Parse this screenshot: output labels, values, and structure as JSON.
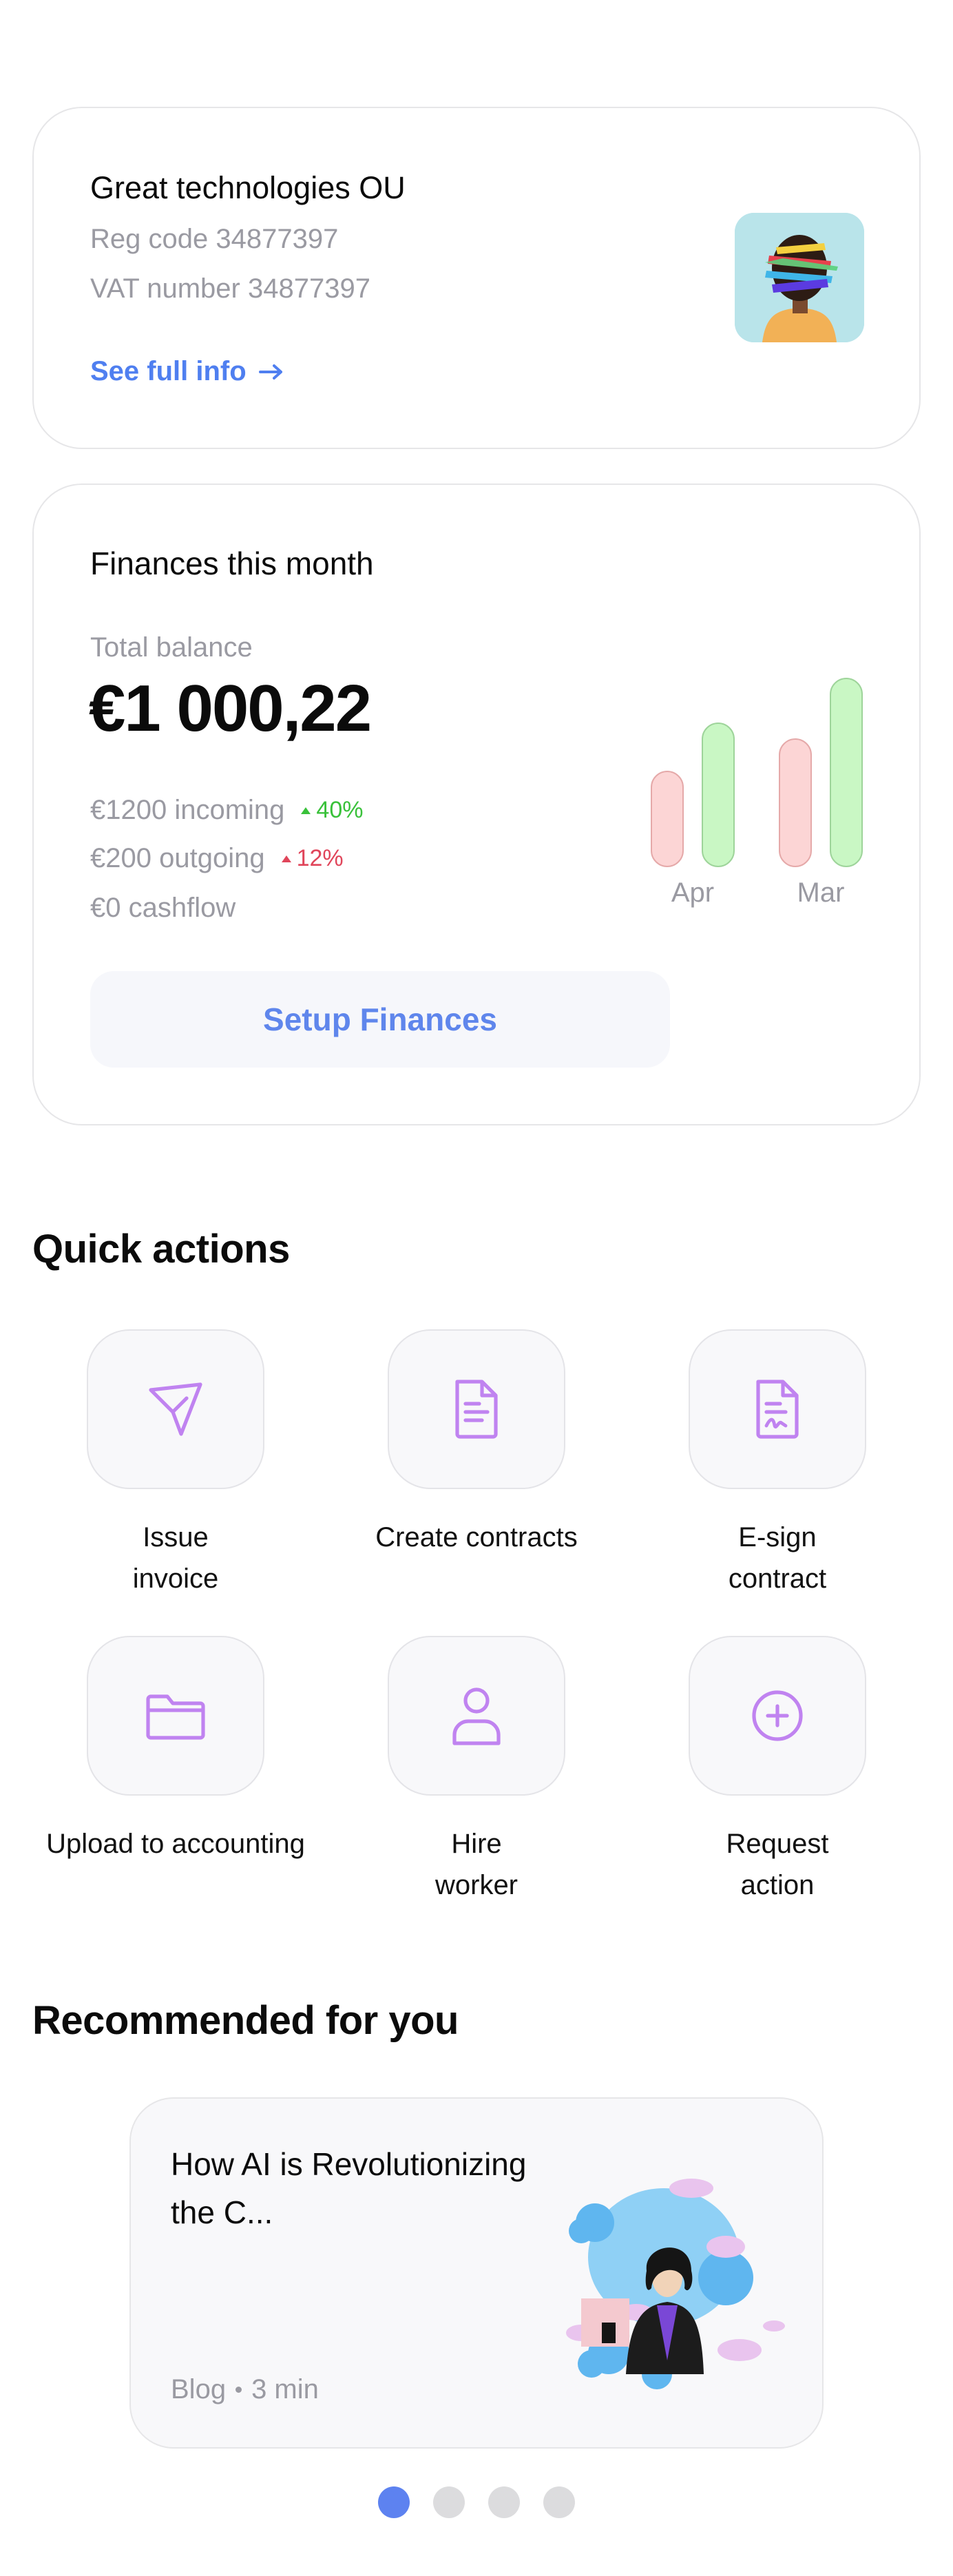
{
  "company": {
    "name": "Great technologies OU",
    "reg_code": "Reg code 34877397",
    "vat": "VAT number 34877397",
    "link": "See full info"
  },
  "finances": {
    "title": "Finances this month",
    "balance_label": "Total balance",
    "balance": "€1 000,22",
    "incoming": "€1200 incoming",
    "incoming_pct": "40%",
    "outgoing": "€200 outgoing",
    "outgoing_pct": "12%",
    "cashflow": "€0 cashflow",
    "setup": "Setup Finances",
    "chart_data": {
      "type": "bar",
      "categories": [
        "Apr",
        "Mar"
      ],
      "series": [
        {
          "values": [
            150,
            200
          ]
        },
        {
          "values": [
            225,
            295
          ]
        }
      ],
      "colors": [
        "#fcd5d5",
        "#c9f7c4"
      ]
    }
  },
  "quick": {
    "title": "Quick actions",
    "items": [
      {
        "label": "Issue invoice",
        "icon": "send-icon"
      },
      {
        "label": "Create contracts",
        "icon": "document-icon"
      },
      {
        "label": "E-sign contract",
        "icon": "signed-document-icon"
      },
      {
        "label": "Upload to accounting",
        "icon": "folder-icon"
      },
      {
        "label": "Hire worker",
        "icon": "person-icon"
      },
      {
        "label": "Request action",
        "icon": "plus-circle-icon"
      }
    ]
  },
  "recommended": {
    "title": "Recommended for you",
    "card_title": "How AI is Revolutionizing the C...",
    "category": "Blog",
    "duration": "3 min"
  },
  "colors": {
    "accent": "#5d82f0",
    "icon": "#c083f0"
  }
}
